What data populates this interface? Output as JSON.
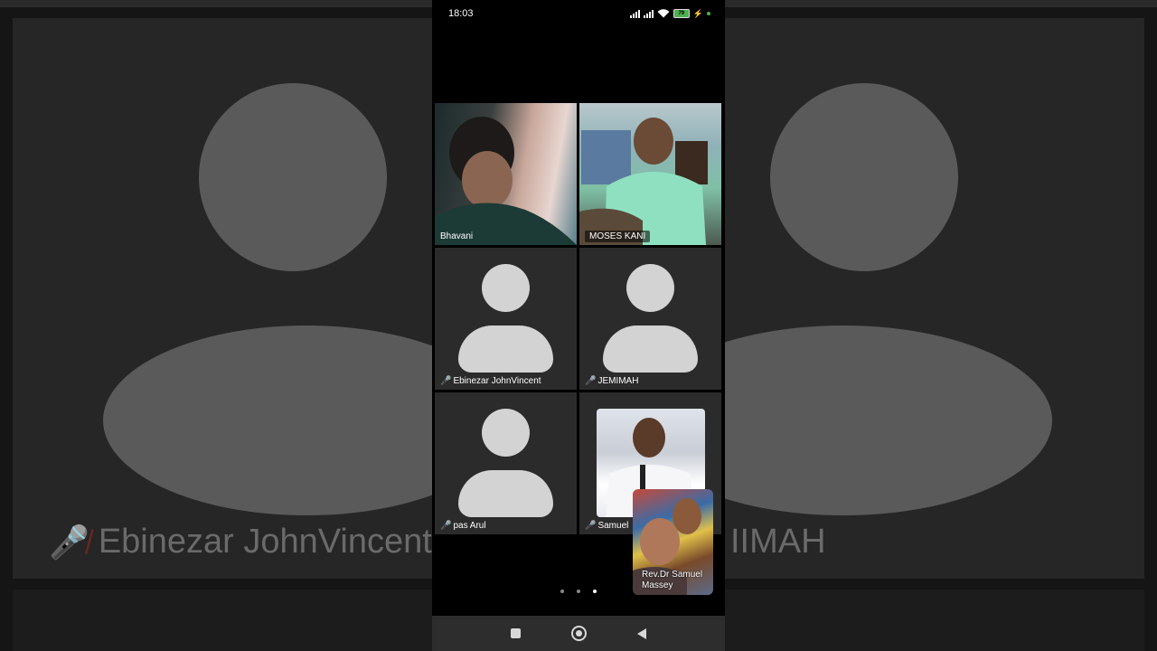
{
  "status_bar": {
    "time": "18:03",
    "battery": "79"
  },
  "participants": [
    {
      "name": "Bhavani",
      "muted": false,
      "video": true
    },
    {
      "name": "MOSES KANI",
      "muted": false,
      "video": true
    },
    {
      "name": "Ebinezar JohnVincent",
      "muted": true,
      "video": false
    },
    {
      "name": "JEMIMAH",
      "muted": true,
      "video": false
    },
    {
      "name": "pas Arul",
      "muted": true,
      "video": false
    },
    {
      "name": "Samuel",
      "muted": true,
      "video": true
    }
  ],
  "pip": {
    "name_line1": "Rev.Dr Samuel",
    "name_line2": "Massey"
  },
  "background": {
    "left_name": "Ebinezar JohnVincent",
    "right_name": "IIMAH"
  },
  "pager": {
    "count": 3,
    "active": 3
  },
  "icons": {
    "mic_off": "mic-off-icon",
    "nav": [
      "recents-icon",
      "home-icon",
      "back-icon"
    ]
  },
  "colors": {
    "mic_off": "#e04040",
    "tile_bg": "#2b2b2b",
    "avatar": "#d3d3d3"
  }
}
